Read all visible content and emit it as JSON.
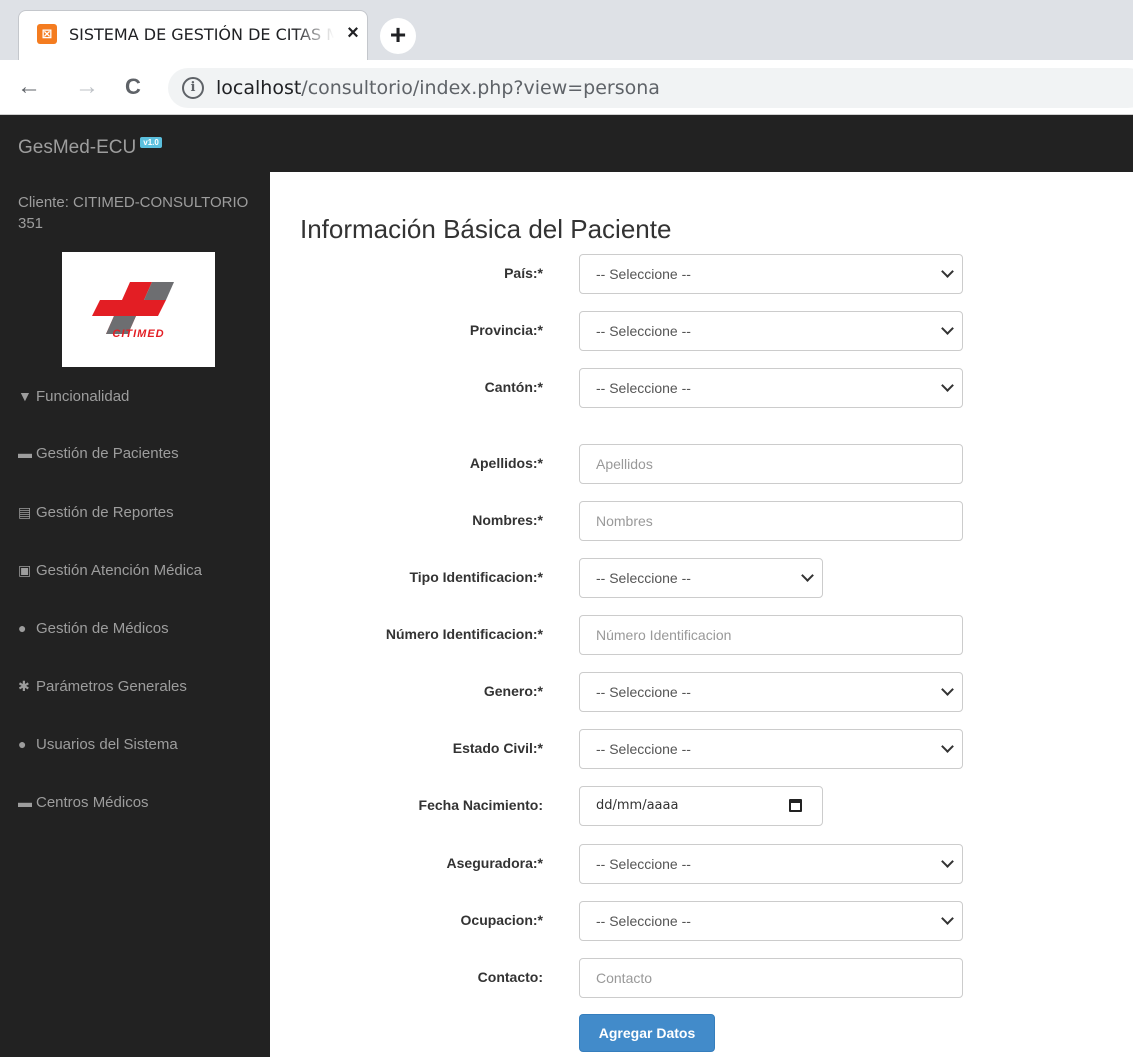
{
  "browser": {
    "tab_title": "SISTEMA DE GESTIÓN DE CITAS MÉDICAS",
    "tab_close": "×",
    "new_tab": "+",
    "url_host": "localhost",
    "url_path": "/consultorio/index.php?view=persona",
    "back_icon": "←",
    "forward_icon": "→",
    "reload_icon": "C",
    "info_icon": "i"
  },
  "app": {
    "brand": "GesMed-ECU",
    "version_badge": "v1.0"
  },
  "sidebar": {
    "client": "Cliente: CITIMED-CONSULTORIO 351",
    "logo_text": "CITIMED",
    "items": [
      {
        "icon": "filter-icon",
        "glyph": "▼",
        "label": "Funcionalidad"
      },
      {
        "icon": "folder-icon",
        "glyph": "▬",
        "label": "Gestión de Pacientes"
      },
      {
        "icon": "report-icon",
        "glyph": "▤",
        "label": "Gestión de Reportes"
      },
      {
        "icon": "id-card-icon",
        "glyph": "▣",
        "label": "Gestión Atención Médica"
      },
      {
        "icon": "user-icon",
        "glyph": "●",
        "label": "Gestión de Médicos"
      },
      {
        "icon": "gear-icon",
        "glyph": "✱",
        "label": "Parámetros Generales"
      },
      {
        "icon": "users-icon",
        "glyph": "●",
        "label": "Usuarios del Sistema"
      },
      {
        "icon": "briefcase-icon",
        "glyph": "▬",
        "label": "Centros Médicos"
      }
    ]
  },
  "form": {
    "title": "Información Básica del Paciente",
    "fields": {
      "pais": {
        "label": "País:*",
        "value": "-- Seleccione --"
      },
      "provincia": {
        "label": "Provincia:*",
        "value": "-- Seleccione --"
      },
      "canton": {
        "label": "Cantón:*",
        "value": "-- Seleccione --"
      },
      "apellidos": {
        "label": "Apellidos:*",
        "placeholder": "Apellidos"
      },
      "nombres": {
        "label": "Nombres:*",
        "placeholder": "Nombres"
      },
      "tipo_id": {
        "label": "Tipo Identificacion:*",
        "value": "-- Seleccione --"
      },
      "numero_id": {
        "label": "Número Identificacion:*",
        "placeholder": "Número Identificacion"
      },
      "genero": {
        "label": "Genero:*",
        "value": "-- Seleccione --"
      },
      "estado_civil": {
        "label": "Estado Civil:*",
        "value": "-- Seleccione --"
      },
      "fecha_nac": {
        "label": "Fecha Nacimiento:",
        "value": "dd/mm/aaaa"
      },
      "aseguradora": {
        "label": "Aseguradora:*",
        "value": "-- Seleccione --"
      },
      "ocupacion": {
        "label": "Ocupacion:*",
        "value": "-- Seleccione --"
      },
      "contacto": {
        "label": "Contacto:",
        "placeholder": "Contacto"
      }
    },
    "submit_label": "Agregar Datos"
  }
}
